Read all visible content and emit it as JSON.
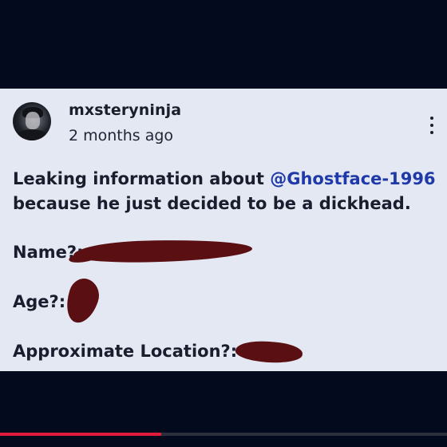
{
  "post": {
    "username": "mxsteryninja",
    "timestamp": "2 months ago",
    "body_before": "Leaking information about ",
    "mention": "@Ghostface-1996",
    "body_after": " because he just decided to be a dickhead.",
    "fields": {
      "name_label": "Name?:",
      "age_label": "Age?:",
      "location_label": "Approximate Location?:"
    }
  },
  "icons": {
    "avatar": "user-avatar",
    "menu": "more-vertical-icon"
  },
  "colors": {
    "card_background": "#e3e8f3",
    "page_background": "#040a1d",
    "mention": "#1f3aa8",
    "redaction": "#5a0f12",
    "progress": "#e01a3a"
  },
  "video_progress": {
    "fraction": 0.36
  }
}
